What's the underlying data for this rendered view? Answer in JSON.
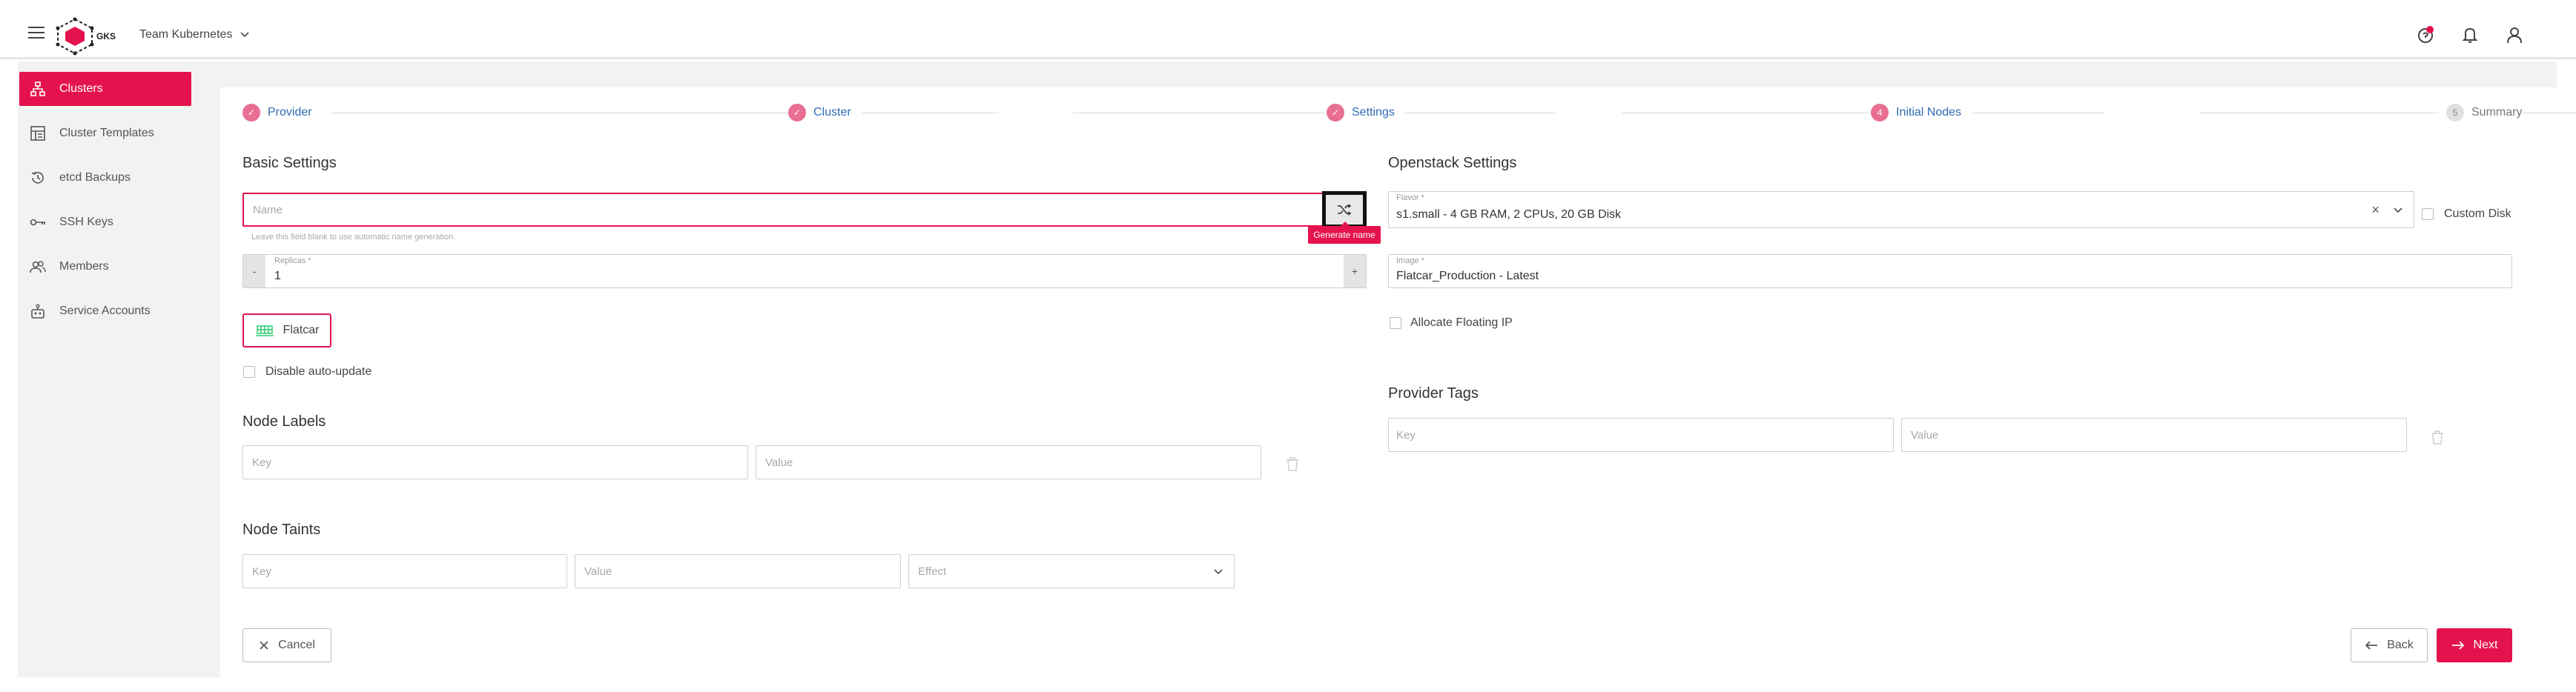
{
  "header": {
    "logo_text": "GKS",
    "project": "Team Kubernetes"
  },
  "sidebar": {
    "items": [
      {
        "label": "Clusters",
        "icon": "hierarchy-icon",
        "active": true
      },
      {
        "label": "Cluster Templates",
        "icon": "template-icon",
        "active": false
      },
      {
        "label": "etcd Backups",
        "icon": "history-icon",
        "active": false
      },
      {
        "label": "SSH Keys",
        "icon": "key-icon",
        "active": false
      },
      {
        "label": "Members",
        "icon": "members-icon",
        "active": false
      },
      {
        "label": "Service Accounts",
        "icon": "robot-icon",
        "active": false
      }
    ]
  },
  "stepper": {
    "steps": [
      {
        "label": "Provider",
        "state": "done"
      },
      {
        "label": "Cluster",
        "state": "done"
      },
      {
        "label": "Settings",
        "state": "done"
      },
      {
        "label": "Initial Nodes",
        "state": "current",
        "number": "4"
      },
      {
        "label": "Summary",
        "state": "pending",
        "number": "5"
      }
    ]
  },
  "basic_settings": {
    "title": "Basic Settings",
    "name_placeholder": "Name",
    "name_hint": "Leave this field blank to use automatic name generation.",
    "generate_tooltip": "Generate name",
    "replicas_label": "Replicas *",
    "replicas_value": "1",
    "minus": "-",
    "plus": "+",
    "os_label": "Flatcar",
    "disable_autoupdate_label": "Disable auto-update"
  },
  "node_labels": {
    "title": "Node Labels",
    "key_placeholder": "Key",
    "value_placeholder": "Value"
  },
  "node_taints": {
    "title": "Node Taints",
    "key_placeholder": "Key",
    "value_placeholder": "Value",
    "effect_placeholder": "Effect"
  },
  "openstack_settings": {
    "title": "Openstack Settings",
    "flavor_label": "Flavor *",
    "flavor_value": "s1.small - 4 GB RAM, 2 CPUs, 20 GB Disk",
    "custom_disk_label": "Custom Disk",
    "image_label": "Image *",
    "image_value": "Flatcar_Production - Latest",
    "floating_ip_label": "Allocate Floating IP"
  },
  "provider_tags": {
    "title": "Provider Tags",
    "key_placeholder": "Key",
    "value_placeholder": "Value"
  },
  "footer": {
    "cancel": "Cancel",
    "back": "Back",
    "next": "Next"
  },
  "colors": {
    "accent": "#e5134d",
    "link": "#2f6bb3",
    "flatcar_green": "#2ecc71"
  }
}
